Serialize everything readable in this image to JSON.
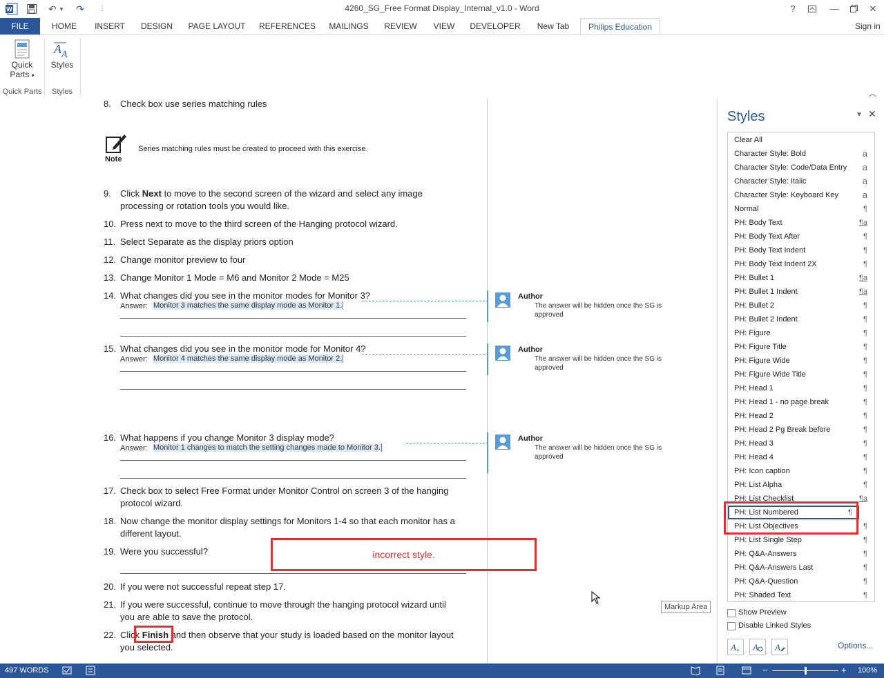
{
  "window": {
    "title": "4260_SG_Free Format Display_Internal_v1.0 - Word",
    "help": "?",
    "sign_in": "Sign in"
  },
  "ribbon": {
    "tabs": [
      "FILE",
      "HOME",
      "INSERT",
      "DESIGN",
      "PAGE LAYOUT",
      "REFERENCES",
      "MAILINGS",
      "REVIEW",
      "VIEW",
      "DEVELOPER",
      "New Tab",
      "Philips Education"
    ],
    "quick_parts_line1": "Quick",
    "quick_parts_line2": "Parts",
    "styles_btn": "Styles",
    "group_quick_parts": "Quick Parts",
    "group_styles": "Styles"
  },
  "document": {
    "items": [
      {
        "n": "8.",
        "text": "Check box use series matching rules"
      },
      {
        "n": "9.",
        "text_pre": "Click ",
        "text_bold": "Next",
        "text_post": " to move to the second screen of the wizard and select any image processing or rotation tools you would like."
      },
      {
        "n": "10.",
        "text": "Press next to move to the third screen of the Hanging protocol wizard."
      },
      {
        "n": "11.",
        "text": "Select Separate as the display priors option"
      },
      {
        "n": "12.",
        "text": "Change monitor preview to four"
      },
      {
        "n": "13.",
        "text": "Change Monitor 1 Mode = M6 and Monitor 2 Mode = M25"
      },
      {
        "n": "14.",
        "text": "What changes did you see in the monitor modes for Monitor 3?",
        "answer": "Monitor 3 matches the same display mode as Monitor 1."
      },
      {
        "n": "15.",
        "text": "What changes did you see in the monitor mode for Monitor 4?",
        "answer": "Monitor 4 matches the same display mode as Monitor 2."
      },
      {
        "n": "16.",
        "text": "What happens if you change Monitor 3 display mode?",
        "answer": "Monitor 1 changes to match the setting changes made to Monitor 3."
      },
      {
        "n": "17.",
        "text": "Check box to select Free Format under Monitor Control on screen 3 of the hanging protocol wizard."
      },
      {
        "n": "18.",
        "text": "Now change the monitor display settings for Monitors 1-4 so that each monitor has a different layout."
      },
      {
        "n": "19.",
        "text": "Were you successful?"
      },
      {
        "n": "20.",
        "text": "If you were not successful repeat step 17."
      },
      {
        "n": "21.",
        "text": "If you were successful, continue to move through the hanging protocol wizard until you are able to save the protocol."
      },
      {
        "n": "22.",
        "text_pre": "Click ",
        "text_bold": "Finish",
        "text_post": " and then observe that your study is loaded based on the monitor layout you selected."
      }
    ],
    "note_label": "Note",
    "note_text": "Series matching rules must be created to proceed with this exercise.",
    "answer_label": "Answer:",
    "annotation": "incorrect style.",
    "markup_area_tooltip": "Markup Area"
  },
  "comments": [
    {
      "author": "Author",
      "text": "The answer will be hidden once the SG is approved"
    },
    {
      "author": "Author",
      "text": "The answer will be hidden once the SG is approved"
    },
    {
      "author": "Author",
      "text": "The answer will be hidden once the SG is approved"
    }
  ],
  "styles_pane": {
    "title": "Styles",
    "styles": [
      {
        "name": "Clear All",
        "mark": ""
      },
      {
        "name": "Character Style: Bold",
        "mark": "a"
      },
      {
        "name": "Character Style: Code/Data Entry",
        "mark": "a"
      },
      {
        "name": "Character Style: Italic",
        "mark": "a"
      },
      {
        "name": "Character Style: Keyboard Key",
        "mark": "a"
      },
      {
        "name": "Normal",
        "mark": "¶"
      },
      {
        "name": "PH: Body Text",
        "mark": "¶a"
      },
      {
        "name": "PH: Body Text After",
        "mark": "¶"
      },
      {
        "name": "PH: Body Text Indent",
        "mark": "¶"
      },
      {
        "name": "PH: Body Text Indent 2X",
        "mark": "¶"
      },
      {
        "name": "PH: Bullet 1",
        "mark": "¶a"
      },
      {
        "name": "PH: Bullet 1 Indent",
        "mark": "¶a"
      },
      {
        "name": "PH: Bullet 2",
        "mark": "¶"
      },
      {
        "name": "PH: Bullet 2 Indent",
        "mark": "¶"
      },
      {
        "name": "PH: Figure",
        "mark": "¶"
      },
      {
        "name": "PH: Figure Title",
        "mark": "¶"
      },
      {
        "name": "PH: Figure Wide",
        "mark": "¶"
      },
      {
        "name": "PH: Figure Wide Title",
        "mark": "¶"
      },
      {
        "name": "PH: Head 1",
        "mark": "¶"
      },
      {
        "name": "PH: Head 1 - no page break",
        "mark": "¶"
      },
      {
        "name": "PH: Head 2",
        "mark": "¶"
      },
      {
        "name": "PH: Head 2 Pg Break before",
        "mark": "¶"
      },
      {
        "name": "PH: Head 3",
        "mark": "¶"
      },
      {
        "name": "PH: Head 4",
        "mark": "¶"
      },
      {
        "name": "PH: Icon caption",
        "mark": "¶"
      },
      {
        "name": "PH: List Alpha",
        "mark": "¶"
      },
      {
        "name": "PH: List Checklist",
        "mark": "¶a"
      },
      {
        "name": "PH: List Numbered",
        "mark": "¶"
      },
      {
        "name": "PH: List Objectives",
        "mark": "¶"
      },
      {
        "name": "PH: List Single Step",
        "mark": "¶"
      },
      {
        "name": "PH: Q&A-Answers",
        "mark": "¶"
      },
      {
        "name": "PH: Q&A-Answers Last",
        "mark": "¶"
      },
      {
        "name": "PH: Q&A-Question",
        "mark": "¶"
      },
      {
        "name": "PH: Shaded Text",
        "mark": "¶"
      }
    ],
    "selected_style": "PH: List Numbered",
    "show_preview": "Show Preview",
    "disable_linked": "Disable Linked Styles",
    "options": "Options..."
  },
  "status": {
    "words": "497 WORDS",
    "zoom": "100%",
    "zoom_level": 0.5
  },
  "colors": {
    "accent": "#2b579a",
    "annotation": "#e03030",
    "comment": "#5b9bd5"
  }
}
